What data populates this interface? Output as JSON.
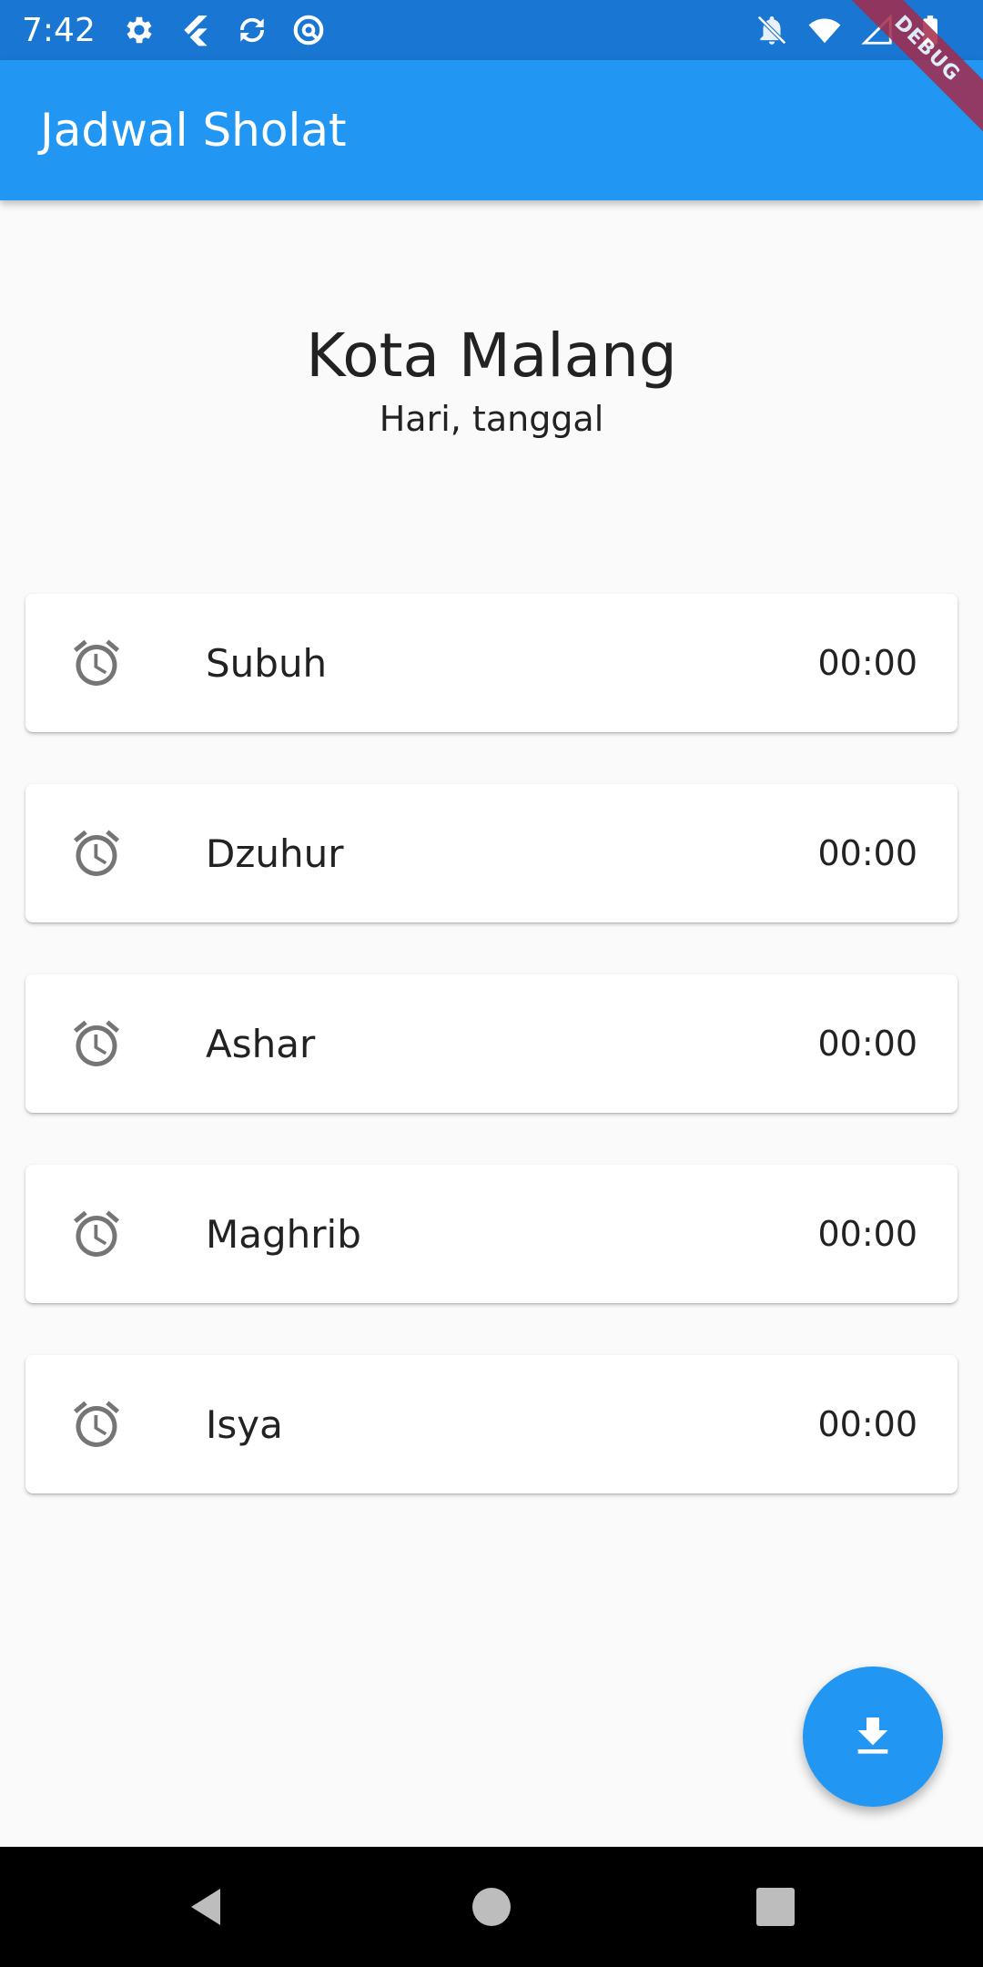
{
  "status_bar": {
    "time": "7:42",
    "left_icons": [
      "gear-icon",
      "flutter-icon",
      "sync-icon",
      "at-icon"
    ],
    "right_icons": [
      "notifications-off-icon",
      "wifi-icon",
      "signal-icon",
      "battery-icon"
    ]
  },
  "debug_banner": {
    "label": "DEBUG"
  },
  "app_bar": {
    "title": "Jadwal Sholat"
  },
  "header": {
    "city": "Kota Malang",
    "date": "Hari, tanggal"
  },
  "prayers": [
    {
      "name": "Subuh",
      "time": "00:00",
      "icon": "alarm-icon"
    },
    {
      "name": "Dzuhur",
      "time": "00:00",
      "icon": "alarm-icon"
    },
    {
      "name": "Ashar",
      "time": "00:00",
      "icon": "alarm-icon"
    },
    {
      "name": "Maghrib",
      "time": "00:00",
      "icon": "alarm-icon"
    },
    {
      "name": "Isya",
      "time": "00:00",
      "icon": "alarm-icon"
    }
  ],
  "fab": {
    "icon": "download-icon"
  },
  "nav_bar": {
    "buttons": [
      "back-icon",
      "home-icon",
      "recents-icon"
    ]
  },
  "colors": {
    "status_bar": "#1976d2",
    "app_bar": "#2196f3",
    "fab": "#2196f3",
    "icon_gray": "#757575",
    "background": "#fafafa"
  }
}
